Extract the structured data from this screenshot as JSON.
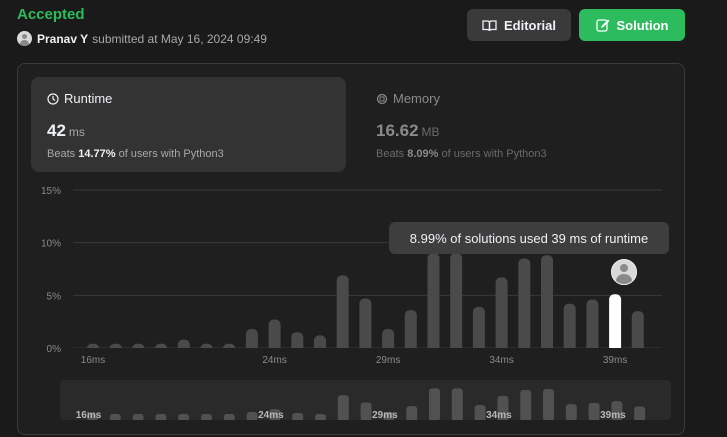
{
  "header": {
    "status": "Accepted",
    "username": "Pranav Y",
    "submitted_text": "submitted at May 16, 2024 09:49",
    "editorial_label": "Editorial",
    "solution_label": "Solution"
  },
  "runtime": {
    "title": "Runtime",
    "value": "42",
    "unit": "ms",
    "beats_prefix": "Beats",
    "beats_pct": "14.77%",
    "beats_suffix": "of users with Python3"
  },
  "memory": {
    "title": "Memory",
    "value": "16.62",
    "unit": "MB",
    "beats_prefix": "Beats",
    "beats_pct": "8.09%",
    "beats_suffix": "of users with Python3"
  },
  "tooltip": "8.99% of solutions used 39 ms of runtime",
  "colors": {
    "accent_green": "#2cbb5d",
    "bar": "#4a4a4a",
    "bar_selected": "#ffffff",
    "minimap_bar": "#515151"
  },
  "chart_data": {
    "type": "bar",
    "x": [
      16,
      17,
      18,
      19,
      20,
      21,
      22,
      23,
      24,
      25,
      26,
      27,
      28,
      29,
      30,
      31,
      32,
      33,
      34,
      35,
      36,
      37,
      38,
      39,
      40
    ],
    "values": [
      0.4,
      0.4,
      0.4,
      0.4,
      0.8,
      0.4,
      0.4,
      1.8,
      2.7,
      1.5,
      1.2,
      6.9,
      4.7,
      1.8,
      3.6,
      8.99,
      8.99,
      3.9,
      6.7,
      8.5,
      8.8,
      4.2,
      4.6,
      5.1,
      3.5
    ],
    "selected_index": 23,
    "x_tick_labels": [
      "16ms",
      "24ms",
      "29ms",
      "34ms",
      "39ms"
    ],
    "y_tick_labels": [
      "15%",
      "10%",
      "5%",
      "0%"
    ],
    "ylim": [
      0,
      15
    ],
    "grid": true
  }
}
